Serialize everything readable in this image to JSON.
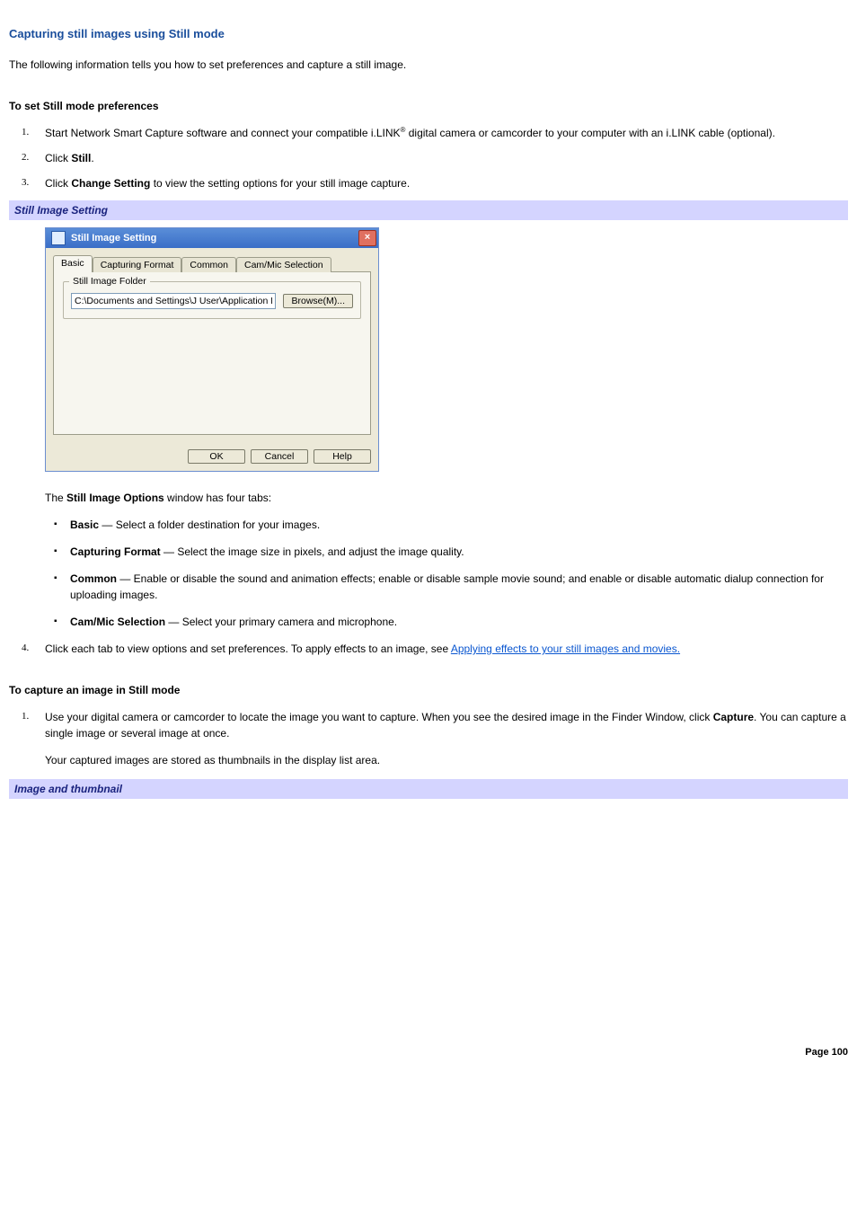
{
  "title": "Capturing still images using Still mode",
  "intro": "The following information tells you how to set preferences and capture a still image.",
  "set_prefs_heading": "To set Still mode preferences",
  "steps_a": {
    "s1_a": "Start Network Smart Capture software and connect your compatible i.LINK",
    "s1_reg": "®",
    "s1_b": " digital camera or camcorder to your computer with an i.LINK cable (optional).",
    "s2_a": "Click ",
    "s2_bold": "Still",
    "s2_b": ".",
    "s3_a": "Click ",
    "s3_bold": "Change Setting",
    "s3_b": " to view the setting options for your still image capture."
  },
  "caption1": "Still Image Setting",
  "dialog": {
    "title": "Still Image Setting",
    "tabs": {
      "basic": "Basic",
      "capfmt": "Capturing Format",
      "common": "Common",
      "cammic": "Cam/Mic Selection"
    },
    "legend": "Still Image Folder",
    "path": "C:\\Documents and Settings\\J User\\Application Data\\So",
    "browse": "Browse(M)...",
    "ok": "OK",
    "cancel": "Cancel",
    "help": "Help"
  },
  "options_intro_a": "The ",
  "options_intro_bold": "Still Image Options",
  "options_intro_b": " window has four tabs:",
  "bullets": {
    "b1_bold": "Basic",
    "b1_rest": " — Select a folder destination for your images.",
    "b2_bold": "Capturing Format",
    "b2_rest": " — Select the image size in pixels, and adjust the image quality.",
    "b3_bold": "Common",
    "b3_rest": " — Enable or disable the sound and animation effects; enable or disable sample movie sound; and enable or disable automatic dialup connection for uploading images.",
    "b4_bold": "Cam/Mic Selection",
    "b4_rest": " — Select your primary camera and microphone."
  },
  "step4_a": "Click each tab to view options and set preferences. To apply effects to an image, see ",
  "step4_link": "Applying effects to your still images and movies.",
  "capture_heading": "To capture an image in Still mode",
  "capture_s1_a": "Use your digital camera or camcorder to locate the image you want to capture. When you see the desired image in the Finder Window, click ",
  "capture_s1_bold": "Capture",
  "capture_s1_b": ". You can capture a single image or several image at once.",
  "capture_s1_note": "Your captured images are stored as thumbnails in the display list area.",
  "caption2": "Image and thumbnail",
  "page_number": "Page 100"
}
